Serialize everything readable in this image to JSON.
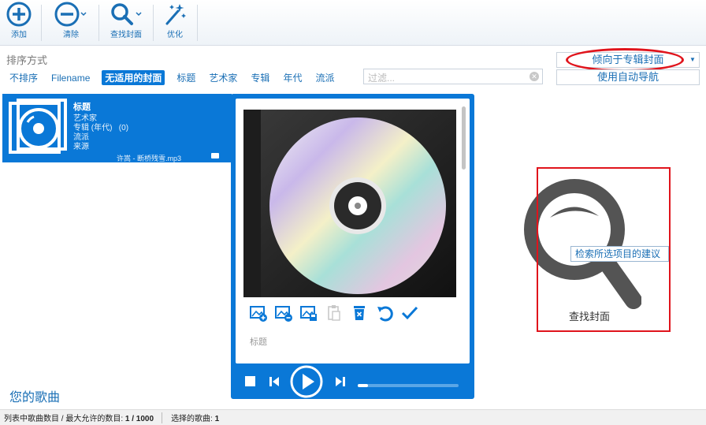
{
  "toolbar": {
    "add_label": "添加",
    "remove_label": "清除",
    "find_cover_label": "查找封面",
    "optimize_label": "优化"
  },
  "sort": {
    "title": "排序方式",
    "options": [
      "不排序",
      "Filename",
      "无适用的封面",
      "标题",
      "艺术家",
      "专辑",
      "年代",
      "流派"
    ],
    "active_index": 2
  },
  "filter": {
    "placeholder": "过滤..."
  },
  "right_panel": {
    "prefer_album_cover": "倾向于专辑封面",
    "use_auto_nav": "使用自动导航"
  },
  "song": {
    "title": "标题",
    "artist": "艺术家",
    "album": "专辑 (年代)",
    "album_count": "(0)",
    "genre": "流派",
    "source": "来源",
    "file": "许嵩 - 断桥残雪.mp3"
  },
  "cover": {
    "title_label": "标题",
    "progress": 0.1
  },
  "find_cover": {
    "tooltip": "检索所选项目的建议",
    "caption": "查找封面"
  },
  "list_heading": "您的歌曲",
  "status": {
    "count_label": "列表中歌曲数目 / 最大允许的数目:",
    "count_value": "1 / 1000",
    "selected_label": "选择的歌曲:",
    "selected_value": "1"
  },
  "colors": {
    "accent": "#0a78d7",
    "highlight": "#e0141c"
  }
}
